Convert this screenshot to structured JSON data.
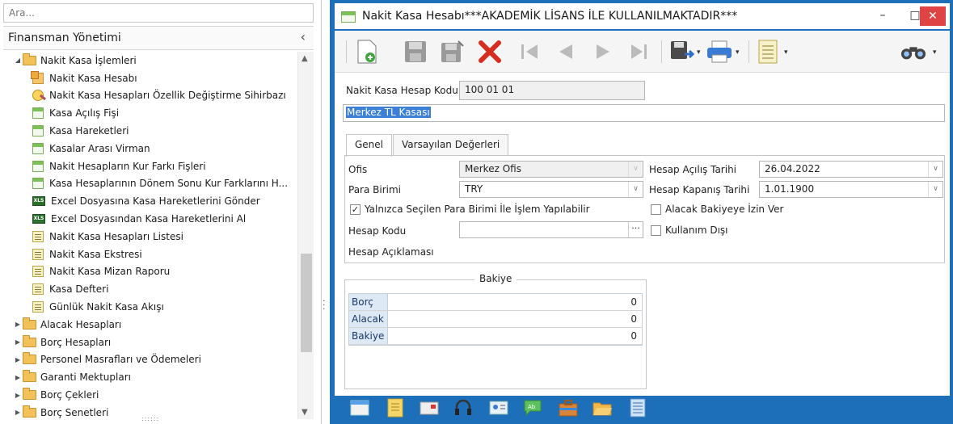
{
  "nav": {
    "search_placeholder": "Ara...",
    "header_title": "Finansman Yönetimi",
    "tree": [
      {
        "label": "Nakit Kasa İşlemleri",
        "level": 0,
        "expanded": true,
        "icon": "folder-icon"
      },
      {
        "label": "Nakit Kasa Hesabı",
        "level": 1,
        "icon": "cash-box-icon"
      },
      {
        "label": "Nakit Kasa Hesapları Özellik Değiştirme Sihirbazı",
        "level": 1,
        "icon": "wizard-icon"
      },
      {
        "label": "Kasa Açılış Fişi",
        "level": 1,
        "icon": "form-icon"
      },
      {
        "label": "Kasa Hareketleri",
        "level": 1,
        "icon": "form-icon"
      },
      {
        "label": "Kasalar Arası Virman",
        "level": 1,
        "icon": "form-icon"
      },
      {
        "label": "Nakit Hesapların Kur Farkı Fişleri",
        "level": 1,
        "icon": "form-icon"
      },
      {
        "label": "Kasa Hesaplarının Dönem Sonu Kur Farklarını H...",
        "level": 1,
        "icon": "form-icon"
      },
      {
        "label": "Excel Dosyasına Kasa Hareketlerini Gönder",
        "level": 1,
        "icon": "excel-icon"
      },
      {
        "label": "Excel Dosyasından Kasa Hareketlerini Al",
        "level": 1,
        "icon": "excel-icon"
      },
      {
        "label": "Nakit Kasa Hesapları Listesi",
        "level": 1,
        "icon": "report-icon"
      },
      {
        "label": "Nakit Kasa Ekstresi",
        "level": 1,
        "icon": "report-icon"
      },
      {
        "label": "Nakit Kasa Mizan Raporu",
        "level": 1,
        "icon": "report-icon"
      },
      {
        "label": "Kasa Defteri",
        "level": 1,
        "icon": "report-icon"
      },
      {
        "label": "Günlük Nakit Kasa Akışı",
        "level": 1,
        "icon": "report-icon"
      },
      {
        "label": "Alacak Hesapları",
        "level": 0,
        "expanded": false,
        "icon": "folder-icon"
      },
      {
        "label": "Borç Hesapları",
        "level": 0,
        "expanded": false,
        "icon": "folder-icon"
      },
      {
        "label": "Personel Masrafları ve Ödemeleri",
        "level": 0,
        "expanded": false,
        "icon": "folder-icon"
      },
      {
        "label": "Garanti Mektupları",
        "level": 0,
        "expanded": false,
        "icon": "folder-icon"
      },
      {
        "label": "Borç Çekleri",
        "level": 0,
        "expanded": false,
        "icon": "folder-icon"
      },
      {
        "label": "Borç Senetleri",
        "level": 0,
        "expanded": false,
        "icon": "folder-icon"
      }
    ]
  },
  "window": {
    "title": "Nakit Kasa Hesabı***AKADEMİK LİSANS İLE KULLANILMAKTADIR***",
    "accent": "#1e6fb9",
    "close_color": "#e04343"
  },
  "form": {
    "code_label": "Nakit Kasa Hesap Kodu",
    "code_value": "100 01 01",
    "name_value": "Merkez TL Kasası",
    "tabs": [
      "Genel",
      "Varsayılan Değerleri"
    ],
    "ofis_label": "Ofis",
    "ofis_value": "Merkez Ofis",
    "para_birimi_label": "Para Birimi",
    "para_birimi_value": "TRY",
    "acilis_label": "Hesap Açılış Tarihi",
    "acilis_value": "26.04.2022",
    "kapanis_label": "Hesap Kapanış Tarihi",
    "kapanis_value": "1.01.1900",
    "only_selected_label": "Yalnızca Seçilen Para Birimi İle İşlem Yapılabilir",
    "only_selected_checked": true,
    "alacak_label": "Alacak Bakiyeye İzin Ver",
    "alacak_checked": false,
    "hesap_kodu_label": "Hesap Kodu",
    "hesap_kodu_value": "",
    "kullanim_label": "Kullanım Dışı",
    "kullanim_checked": false,
    "aciklama_label": "Hesap Açıklaması"
  },
  "balance": {
    "legend": "Bakiye",
    "rows": [
      {
        "label": "Borç",
        "value": "0"
      },
      {
        "label": "Alacak",
        "value": "0"
      },
      {
        "label": "Bakiye",
        "value": "0"
      }
    ]
  },
  "toolbar_icons": [
    "new-document-icon",
    "save-icon",
    "save-as-icon",
    "delete-icon",
    "first-record-icon",
    "previous-record-icon",
    "next-record-icon",
    "last-record-icon",
    "export-icon",
    "print-icon",
    "report-icon",
    "search-binoculars-icon"
  ],
  "footer_icons": [
    "window-icon",
    "notes-icon",
    "email-icon",
    "headset-icon",
    "contact-card-icon",
    "chat-icon",
    "briefcase-icon",
    "folder-open-icon",
    "list-icon"
  ]
}
